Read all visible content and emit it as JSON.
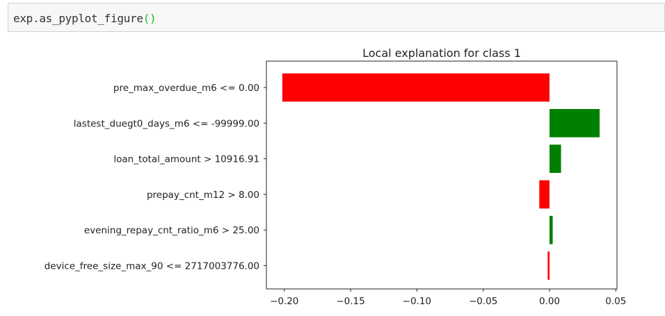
{
  "code_cell": {
    "code": "exp.as_pyplot_figure",
    "parens": "()"
  },
  "colors": {
    "positive": "#008000",
    "negative": "#ff0000"
  },
  "chart_data": {
    "type": "bar",
    "orientation": "horizontal",
    "title": "Local explanation for class 1",
    "xlabel": "",
    "ylabel": "",
    "xlim": [
      -0.2135,
      0.0509
    ],
    "xticks": [
      -0.2,
      -0.15,
      -0.1,
      -0.05,
      0.0,
      0.05
    ],
    "xtick_labels": [
      "−0.20",
      "−0.15",
      "−0.10",
      "−0.05",
      "0.00",
      "0.05"
    ],
    "categories": [
      "pre_max_overdue_m6 <= 0.00",
      "lastest_duegt0_days_m6 <= -99999.00",
      "loan_total_amount > 10916.91",
      "prepay_cnt_m12 > 8.00",
      "evening_repay_cnt_ratio_m6 > 25.00",
      "device_free_size_max_90 <= 2717003776.00"
    ],
    "values": [
      -0.2015,
      0.0378,
      0.0087,
      -0.0077,
      0.0024,
      -0.0014
    ],
    "grid": false
  }
}
